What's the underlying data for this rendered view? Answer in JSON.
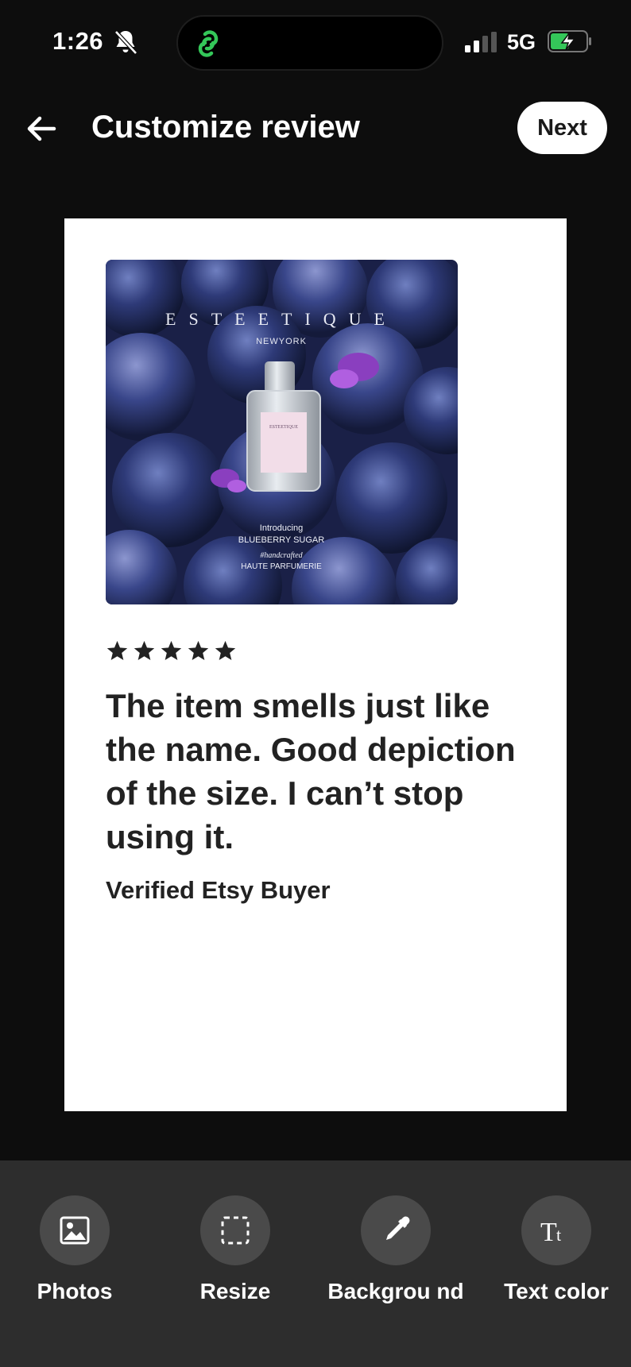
{
  "status_bar": {
    "time": "1:26",
    "network": "5G",
    "icons": [
      "bell-slash-icon",
      "app-activity-icon",
      "signal-icon",
      "battery-charging-icon"
    ]
  },
  "header": {
    "title": "Customize review",
    "back_icon": "arrow-left-icon",
    "next_label": "Next"
  },
  "review_card": {
    "photo": {
      "brand": "ESTEETIQUE",
      "location": "NEWYORK",
      "bottle_label": "ESTEETIQUE",
      "caption_1": "Introducing",
      "caption_2": "BLUEBERRY SUGAR",
      "caption_3": "#handcrafted",
      "caption_4": "HAUTE PARFUMERIE"
    },
    "rating": 5,
    "rating_max": 5,
    "text": "The item smells just like the name. Good depiction of the size. I can’t stop using it.",
    "reviewer": "Verified Etsy Buyer"
  },
  "toolbar": {
    "items": [
      {
        "label": "Photos",
        "icon": "image-icon"
      },
      {
        "label": "Resize",
        "icon": "resize-icon"
      },
      {
        "label": "Backgrou nd",
        "icon": "eyedropper-icon"
      },
      {
        "label": "Text color",
        "icon": "text-size-icon"
      }
    ]
  },
  "colors": {
    "app_background": "#0d0d0d",
    "toolbar_background": "#2d2d2d",
    "card_background": "#ffffff",
    "island_icon": "#34c759",
    "battery_fill": "#34c759"
  }
}
